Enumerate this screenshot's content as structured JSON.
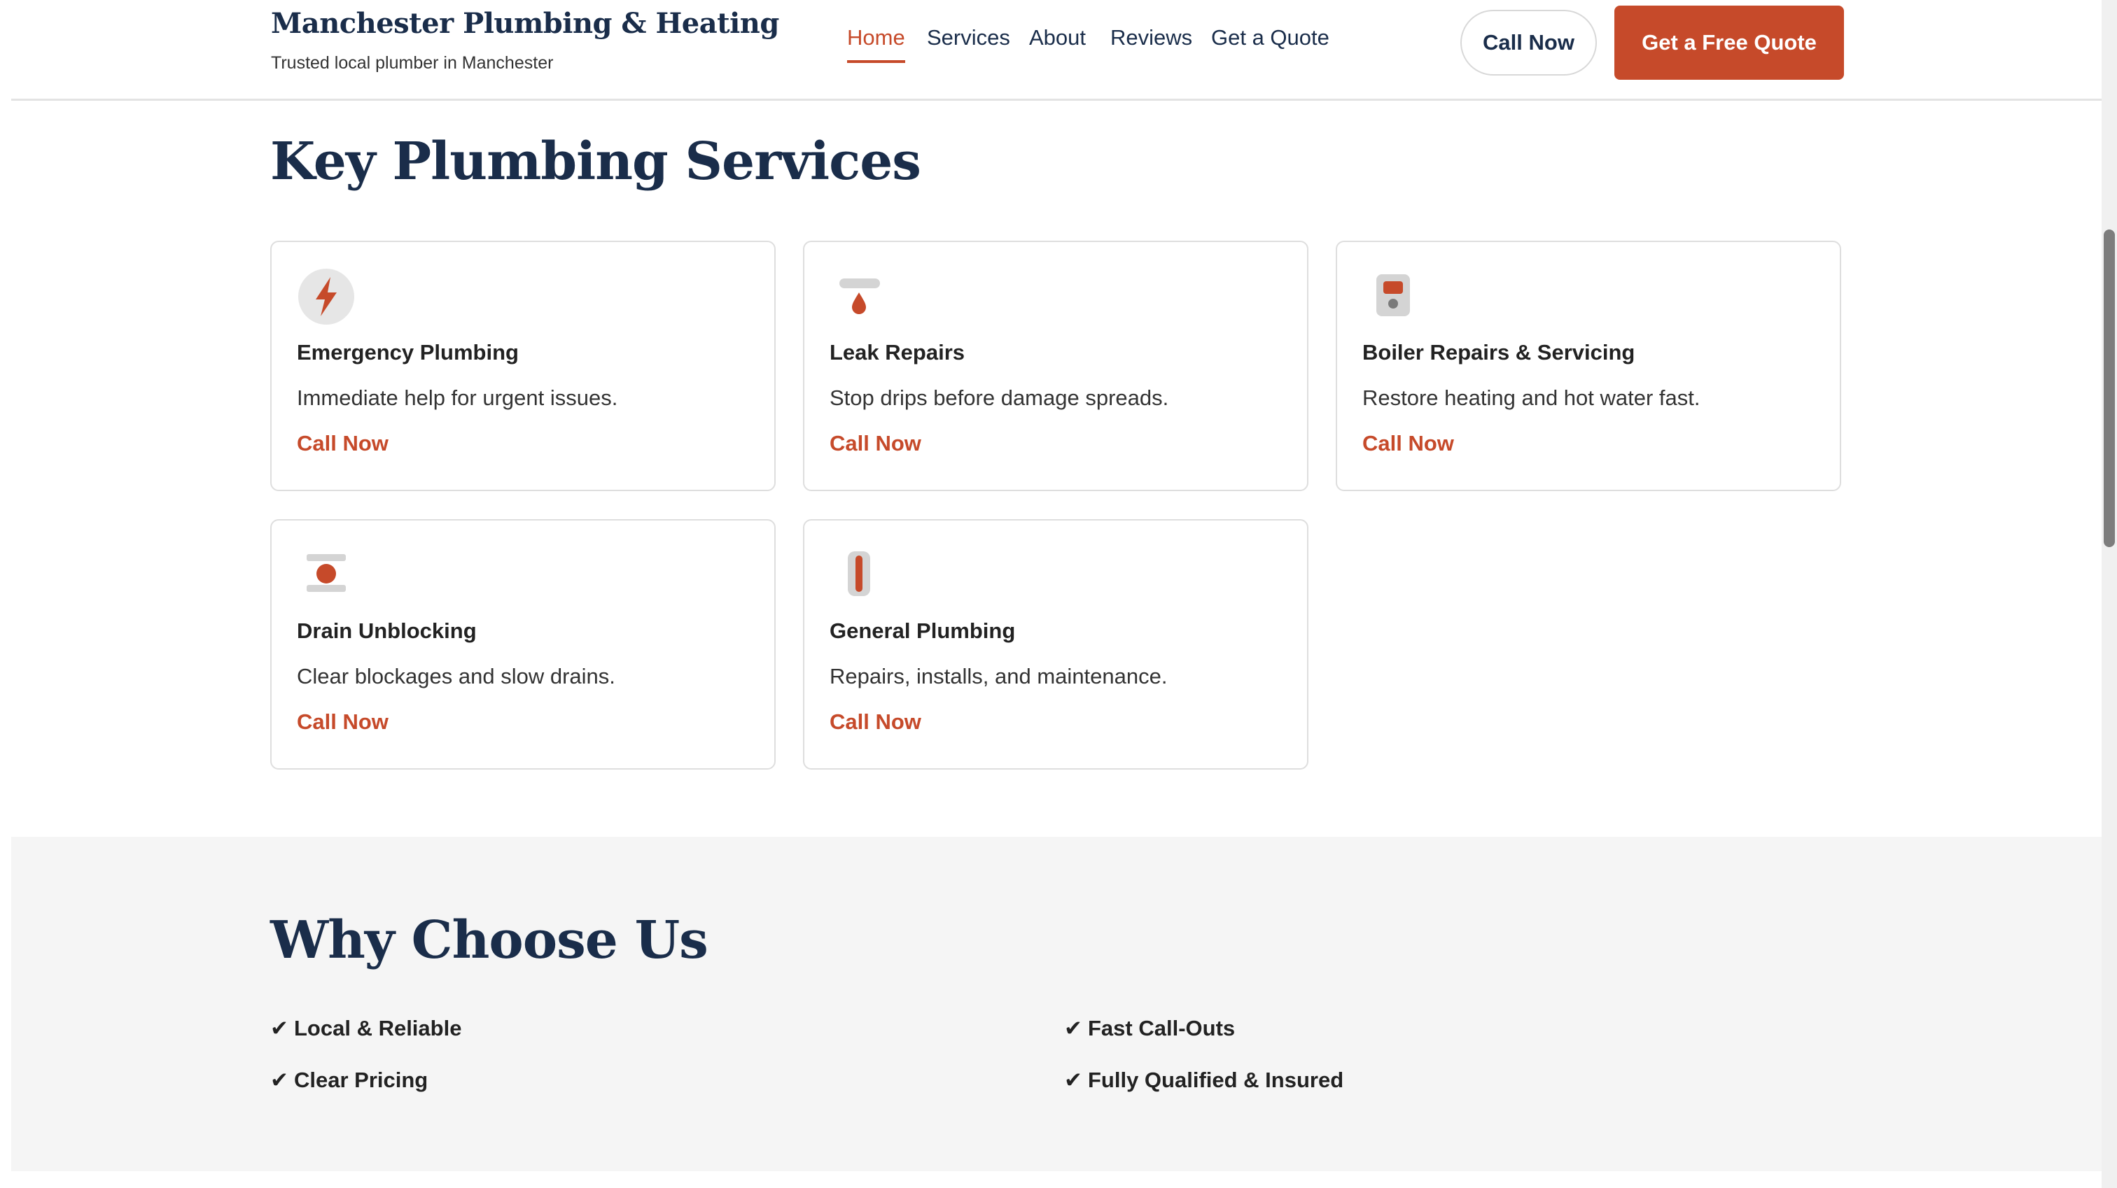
{
  "header": {
    "brand_title": "Manchester Plumbing & Heating",
    "brand_subtitle": "Trusted local plumber in Manchester",
    "nav": [
      {
        "label": "Home",
        "active": true
      },
      {
        "label": "Services",
        "active": false
      },
      {
        "label": "About",
        "active": false
      },
      {
        "label": "Reviews",
        "active": false
      },
      {
        "label": "Get a Quote",
        "active": false
      }
    ],
    "call_button": "Call Now",
    "quote_button": "Get a Free Quote"
  },
  "services": {
    "title": "Key Plumbing Services",
    "cards": [
      {
        "icon": "lightning-icon",
        "title": "Emergency Plumbing",
        "description": "Immediate help for urgent issues.",
        "link": "Call Now"
      },
      {
        "icon": "water-drop-icon",
        "title": "Leak Repairs",
        "description": "Stop drips before damage spreads.",
        "link": "Call Now"
      },
      {
        "icon": "boiler-icon",
        "title": "Boiler Repairs & Servicing",
        "description": "Restore heating and hot water fast.",
        "link": "Call Now"
      },
      {
        "icon": "drain-icon",
        "title": "Drain Unblocking",
        "description": "Clear blockages and slow drains.",
        "link": "Call Now"
      },
      {
        "icon": "pipe-icon",
        "title": "General Plumbing",
        "description": "Repairs, installs, and maintenance.",
        "link": "Call Now"
      }
    ]
  },
  "why": {
    "title": "Why Choose Us",
    "check_symbol": "✔",
    "items": [
      "Local & Reliable",
      "Fast Call-Outs",
      "Clear Pricing",
      "Fully Qualified & Insured"
    ]
  },
  "colors": {
    "accent": "#c64a2a",
    "navy": "#1a2d4a",
    "section_bg": "#f5f5f5"
  }
}
